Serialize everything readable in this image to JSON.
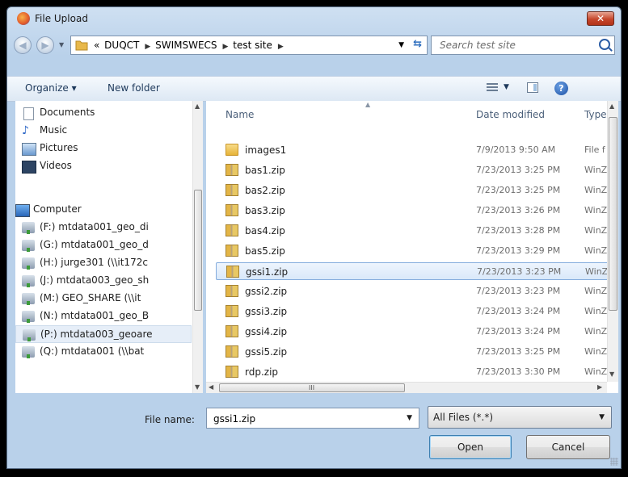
{
  "window": {
    "title": "File Upload",
    "close_glyph": "✕"
  },
  "nav": {
    "back_glyph": "◀",
    "forward_glyph": "▶",
    "breadcrumb": [
      "«",
      "DUQCT",
      "SWIMSWECS",
      "test site"
    ],
    "crumb_sep": "▶",
    "search_placeholder": "Search test site"
  },
  "toolbar": {
    "organize_label": "Organize ▾",
    "new_folder_label": "New folder",
    "help_glyph": "?"
  },
  "sidebar": {
    "items": [
      {
        "label": "Documents",
        "icon": "documents-icon"
      },
      {
        "label": "Music",
        "icon": "music-icon"
      },
      {
        "label": "Pictures",
        "icon": "pictures-icon"
      },
      {
        "label": "Videos",
        "icon": "videos-icon"
      },
      {
        "label": "Computer",
        "icon": "computer-icon"
      },
      {
        "label": "(F:) mtdata001_geo_di",
        "icon": "network-drive-icon"
      },
      {
        "label": "(G:) mtdata001_geo_d",
        "icon": "network-drive-icon"
      },
      {
        "label": "(H:) jurge301 (\\\\it172c",
        "icon": "network-drive-icon"
      },
      {
        "label": "(J:) mtdata003_geo_sh",
        "icon": "network-drive-icon"
      },
      {
        "label": "(M:) GEO_SHARE (\\\\it",
        "icon": "network-drive-icon"
      },
      {
        "label": "(N:) mtdata001_geo_B",
        "icon": "network-drive-icon"
      },
      {
        "label": "(P:) mtdata003_geoare",
        "icon": "network-drive-icon"
      },
      {
        "label": "(Q:) mtdata001 (\\\\bat",
        "icon": "network-drive-icon"
      }
    ],
    "selected_index": 11
  },
  "file_list": {
    "columns": {
      "name": "Name",
      "date": "Date modified",
      "type": "Type"
    },
    "rows": [
      {
        "name": "images1",
        "date": "7/9/2013 9:50 AM",
        "type": "File f",
        "icon": "folder-icon"
      },
      {
        "name": "bas1.zip",
        "date": "7/23/2013 3:25 PM",
        "type": "WinZ",
        "icon": "zip-icon"
      },
      {
        "name": "bas2.zip",
        "date": "7/23/2013 3:25 PM",
        "type": "WinZ",
        "icon": "zip-icon"
      },
      {
        "name": "bas3.zip",
        "date": "7/23/2013 3:26 PM",
        "type": "WinZ",
        "icon": "zip-icon"
      },
      {
        "name": "bas4.zip",
        "date": "7/23/2013 3:28 PM",
        "type": "WinZ",
        "icon": "zip-icon"
      },
      {
        "name": "bas5.zip",
        "date": "7/23/2013 3:29 PM",
        "type": "WinZ",
        "icon": "zip-icon"
      },
      {
        "name": "gssi1.zip",
        "date": "7/23/2013 3:23 PM",
        "type": "WinZ",
        "icon": "zip-icon"
      },
      {
        "name": "gssi2.zip",
        "date": "7/23/2013 3:23 PM",
        "type": "WinZ",
        "icon": "zip-icon"
      },
      {
        "name": "gssi3.zip",
        "date": "7/23/2013 3:24 PM",
        "type": "WinZ",
        "icon": "zip-icon"
      },
      {
        "name": "gssi4.zip",
        "date": "7/23/2013 3:24 PM",
        "type": "WinZ",
        "icon": "zip-icon"
      },
      {
        "name": "gssi5.zip",
        "date": "7/23/2013 3:25 PM",
        "type": "WinZ",
        "icon": "zip-icon"
      },
      {
        "name": "rdp.zip",
        "date": "7/23/2013 3:30 PM",
        "type": "WinZ",
        "icon": "zip-icon"
      }
    ],
    "selected_index": 6,
    "scroll_grip": "III"
  },
  "footer": {
    "file_name_label": "File name:",
    "file_name_value": "gssi1.zip",
    "filter_value": "All Files (*.*)",
    "open_label": "Open",
    "cancel_label": "Cancel"
  },
  "colors": {
    "window_frame": "#b9d1ea",
    "selection": "#d9e8fa",
    "close_button": "#c6472c"
  }
}
